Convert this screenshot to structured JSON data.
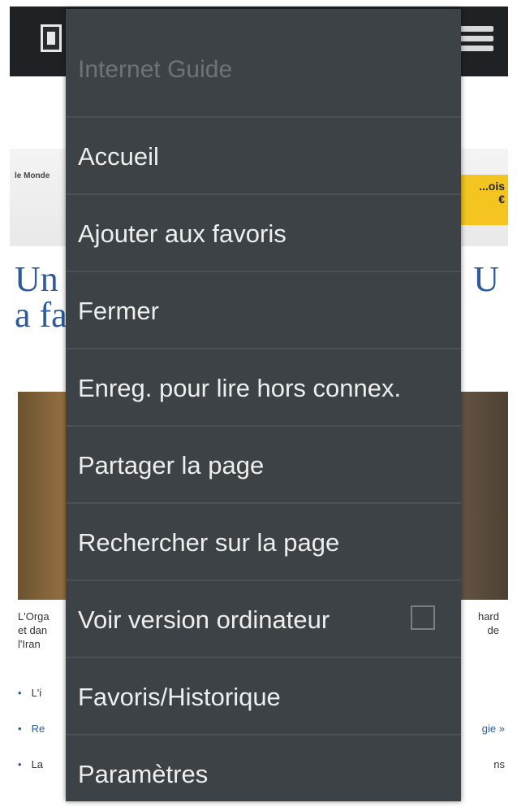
{
  "page": {
    "banner_left_text": "le Monde",
    "promo_text": "...ois\n€",
    "headline_left": "Un\na fa",
    "headline_right": "U",
    "caption_left": "L'Orga\net dan\nl'Iran",
    "caption_right": "hard\nde",
    "bullets": [
      {
        "text": "L'i",
        "right": ""
      },
      {
        "text": "Re",
        "right": "gie »"
      },
      {
        "text": "La",
        "right": "ns"
      }
    ]
  },
  "menu": {
    "title": "Internet Guide",
    "items": [
      {
        "label": "Accueil"
      },
      {
        "label": "Ajouter aux favoris"
      },
      {
        "label": "Fermer"
      },
      {
        "label": "Enreg. pour lire hors connex."
      },
      {
        "label": "Partager la page"
      },
      {
        "label": "Rechercher sur la page"
      },
      {
        "label": "Voir version ordinateur"
      },
      {
        "label": "Favoris/Historique"
      },
      {
        "label": "Paramètres"
      }
    ],
    "desktop_version_checked": false
  },
  "colors": {
    "menu_bg": "#3c4245",
    "menu_text": "#eceeef",
    "link_blue": "#2c5a9a",
    "promo_yellow": "#f4c521"
  }
}
